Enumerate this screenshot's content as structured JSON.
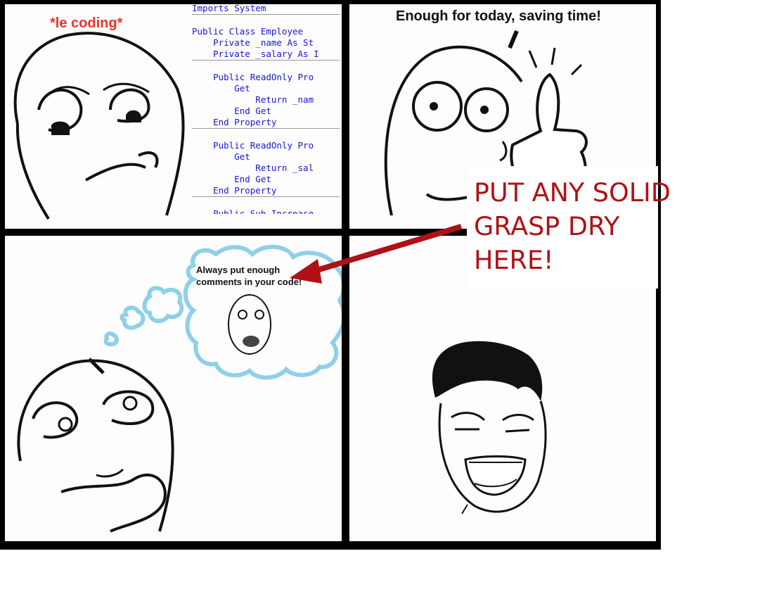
{
  "panel1": {
    "caption": "*le coding*",
    "code_lines": [
      {
        "text": "Imports System",
        "sep_after": true
      },
      {
        "text": "",
        "sep_after": false
      },
      {
        "text": "Public Class Employee",
        "sep_after": false
      },
      {
        "text": "    Private _name As St",
        "sep_after": false
      },
      {
        "text": "    Private _salary As I",
        "sep_after": true
      },
      {
        "text": "",
        "sep_after": false
      },
      {
        "text": "    Public ReadOnly Pro",
        "sep_after": false
      },
      {
        "text": "        Get",
        "sep_after": false
      },
      {
        "text": "            Return _nam",
        "sep_after": false
      },
      {
        "text": "        End Get",
        "sep_after": false
      },
      {
        "text": "    End Property",
        "sep_after": true
      },
      {
        "text": "",
        "sep_after": false
      },
      {
        "text": "    Public ReadOnly Pro",
        "sep_after": false
      },
      {
        "text": "        Get",
        "sep_after": false
      },
      {
        "text": "            Return _sal",
        "sep_after": false
      },
      {
        "text": "        End Get",
        "sep_after": false
      },
      {
        "text": "    End Property",
        "sep_after": true
      },
      {
        "text": "",
        "sep_after": false
      },
      {
        "text": "    Public Sub Increase",
        "sep_after": false
      }
    ]
  },
  "panel2": {
    "caption": "Enough for today, saving time!"
  },
  "panel3": {
    "thought_line1": "Always put enough",
    "thought_line2": "comments in your code!"
  },
  "overlay": {
    "text": "PUT ANY SOLID\nGRASP DRY\nHERE!",
    "color": "#b01116"
  },
  "colors": {
    "red_caption": "#e8332b",
    "code_blue": "#1515d9",
    "cloud": "#8fd0e8"
  }
}
